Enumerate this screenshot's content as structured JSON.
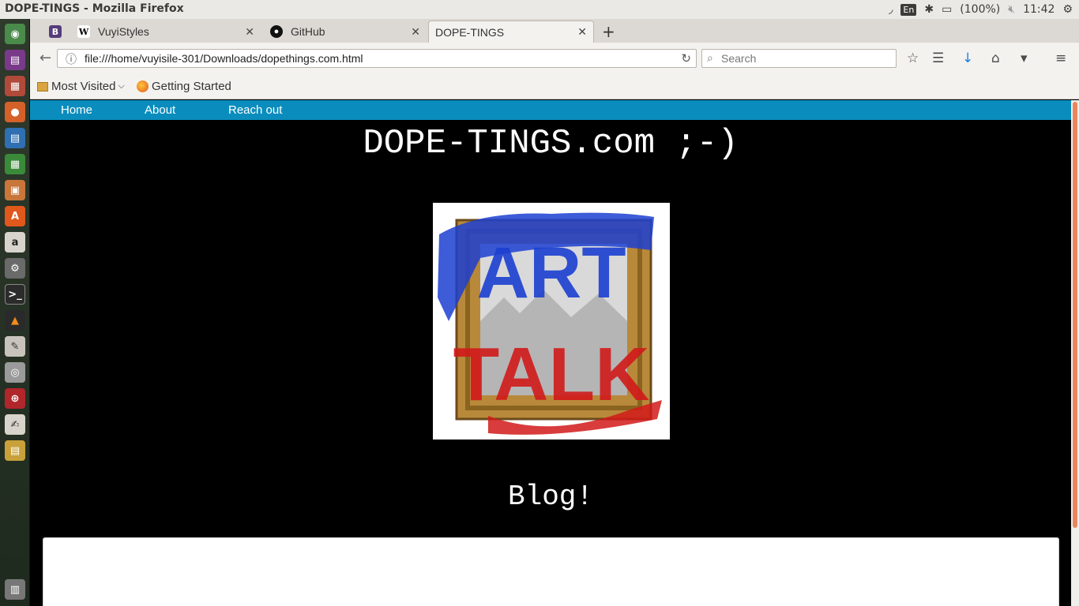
{
  "window": {
    "title": "DOPE-TINGS - Mozilla Firefox"
  },
  "tray": {
    "keyboard": "En",
    "battery": "(100%)",
    "clock": "11:42"
  },
  "tabs": [
    {
      "label": "VuyiStyles",
      "active": false
    },
    {
      "label": "GitHub",
      "active": false
    },
    {
      "label": "DOPE-TINGS",
      "active": true
    }
  ],
  "addressbar": {
    "url": "file:///home/vuyisile-301/Downloads/dopethings.com.html"
  },
  "searchbar": {
    "placeholder": "Search"
  },
  "bookmarks": [
    {
      "label": "Most Visited"
    },
    {
      "label": "Getting Started"
    }
  ],
  "site": {
    "nav": [
      "Home",
      "About",
      "Reach out"
    ],
    "title": "DOPE-TINGS.com ;-)",
    "blog_heading": "Blog!",
    "logo_text_top": "ART",
    "logo_text_bottom": "TALK"
  },
  "colors": {
    "nav_bar": "#0a8dbd",
    "page_bg": "#000000",
    "logo_blue": "#1c3fd1",
    "logo_red": "#d11a1a",
    "frame_gold": "#b8893a"
  }
}
